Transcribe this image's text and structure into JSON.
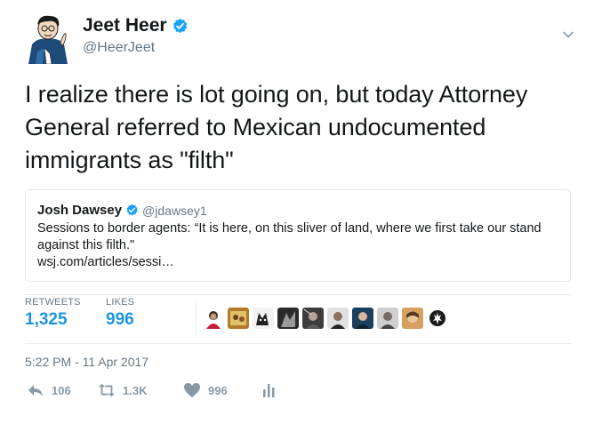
{
  "author": {
    "display_name": "Jeet Heer",
    "handle": "@HeerJeet",
    "verified": true
  },
  "tweet": {
    "text": "I realize there is lot going on, but today Attorney General referred to Mexican undocumented immigrants as \"filth\"",
    "timestamp": "5:22 PM - 11 Apr 2017"
  },
  "quote": {
    "display_name": "Josh Dawsey",
    "handle": "@jdawsey1",
    "text": "Sessions to border agents: “It is here, on this sliver of land, where we first take our stand against this filth.\"",
    "link": "wsj.com/articles/sessi…"
  },
  "stats": {
    "retweets_label": "RETWEETS",
    "retweets_value": "1,325",
    "likes_label": "LIKES",
    "likes_value": "996"
  },
  "actions": {
    "reply_count": "106",
    "retweet_count": "1.3K",
    "like_count": "996"
  },
  "colors": {
    "accent": "#1b95e0",
    "verified": "#1da1f2",
    "muted": "#657786",
    "action": "#8899a6"
  }
}
